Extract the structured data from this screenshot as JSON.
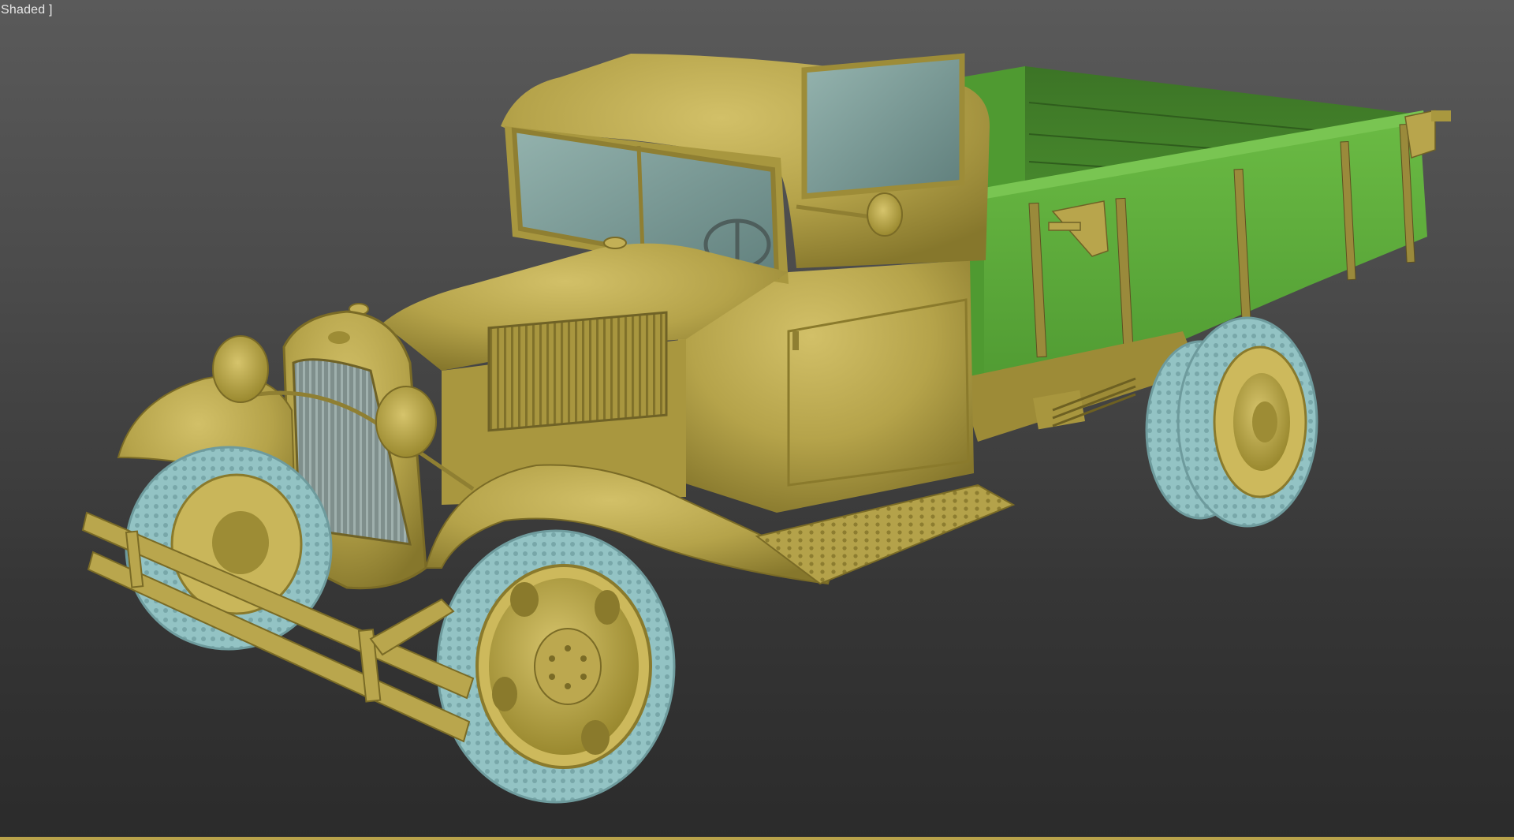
{
  "viewport": {
    "label": "Shaded ]",
    "border_color": "#b8a24a"
  },
  "model": {
    "body_color": "#b5a34a",
    "body_highlight": "#cbb95e",
    "body_shadow": "#8a7a2c",
    "bed_color": "#5aa838",
    "bed_shadow": "#3d7a26",
    "tire_color": "#8fbfc1",
    "glass_color": "#7f9e9a"
  }
}
